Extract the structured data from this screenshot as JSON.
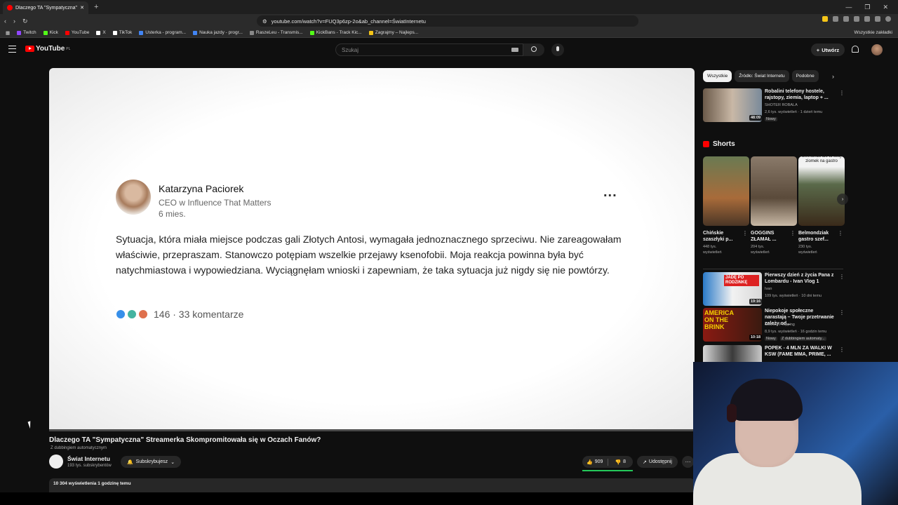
{
  "browser": {
    "tab_title": "Dlaczego TA \"Sympatyczna\"",
    "new_tab": "+",
    "url": "youtube.com/watch?v=FUQ3p6zp-2o&ab_channel=ŚwiatInternetu",
    "bookmarks": [
      {
        "label": "Twitch",
        "color": "#9146ff"
      },
      {
        "label": "Kick",
        "color": "#53fc18"
      },
      {
        "label": "YouTube",
        "color": "#ff0000"
      },
      {
        "label": "X",
        "color": "#ffffff"
      },
      {
        "label": "TikTok",
        "color": "#ffffff"
      },
      {
        "label": "Usterka - program...",
        "color": "#4285f4"
      },
      {
        "label": "Nauka jazdy - progr...",
        "color": "#4285f4"
      },
      {
        "label": "RaszeLeu - Transmis...",
        "color": "#888888"
      },
      {
        "label": "KickBans - Track Kic...",
        "color": "#53fc18"
      },
      {
        "label": "Zagrajmy – Najleps...",
        "color": "#f5c518"
      }
    ],
    "bookmarks_all": "Wszystkie zakładki"
  },
  "youtube": {
    "logo_text": "YouTube",
    "logo_region": "PL",
    "search_placeholder": "Szukaj",
    "create_label": "Utwórz"
  },
  "post": {
    "author": "Katarzyna Paciorek",
    "role": "CEO w Influence That Matters",
    "age": "6 mies.",
    "dots": "...",
    "text": "Sytuacja, która miała miejsce podczas gali Złotych Antosi, wymagała jednoznacznego sprzeciwu. Nie zareagowałam właściwie, przepraszam. Stanowczo potępiam wszelkie przejawy ksenofobii. Moja reakcja powinna była być natychmiastowa i wypowiedziana. Wyciągnęłam wnioski i zapewniam, że taka sytuacja już nigdy się nie powtórzy.",
    "reactions_count": "146 · 33 komentarze"
  },
  "video": {
    "title": "Dlaczego TA \"Sympatyczna\" Streamerka Skompromitowała się w Oczach Fanów?",
    "dubbing": "Z dubbingiem automatycznym",
    "channel": "Świat Internetu",
    "subscribers": "193 tys. subskrybentów",
    "subscribe_label": "Subskrybujesz",
    "likes": "909",
    "dislikes": "8",
    "share_label": "Udostępnij",
    "more": "···",
    "views_line": "10 304 wyświetlenia  1 godzinę temu"
  },
  "sidebar": {
    "chips": [
      "Wszystkie",
      "Źródło: Świat Internetu",
      "Podobne"
    ],
    "recs": [
      {
        "title": "Robalini telefony hostele, rajstopy, ziemia, laptop + ...",
        "channel": "SHOTER ROBALA",
        "meta": "2,6 tys. wyświetleń · 1 dzień temu",
        "badge": "Nowy",
        "duration": "48:09"
      },
      {
        "title": "Pierwszy dzień z życia Pana z Lombardu - Ivan Vlog 1",
        "channel": "Ivan",
        "meta": "109 tys. wyświetleń · 10 dni temu",
        "duration": "19:16"
      },
      {
        "title": "Niepokoje społeczne narastają – Twoje przetrwanie zależy od...",
        "channel": "Goshen Prepping",
        "meta": "8,9 tys. wyświetleń · 16 godzin temu",
        "badge": "Nowy",
        "badge2": "Z dubbingiem automaty...",
        "duration": "10:18"
      },
      {
        "title": "POPEK - 4 MLN ZA WALKI W KSW (FAME MMA, PRIME, ...",
        "channel": "",
        "meta": "",
        "duration": ""
      }
    ],
    "shorts_title": "Shorts",
    "shorts": [
      {
        "title": "Chińskie szaszłyki p...",
        "views": "448 tys. wyświetleń"
      },
      {
        "title": "GOGGINS ZŁAMAŁ ...",
        "views": "204 tys. wyświetleń"
      },
      {
        "title": "Belmondziak gastro szef...",
        "views": "230 tys. wyświetleń"
      }
    ],
    "short_overlay": "Belmondo ale to twój ziomek na gastro",
    "thumb_text_1": "JADĘ PO RODZINKĘ",
    "thumb_text_2": "AMERICA ON THE BRINK"
  }
}
